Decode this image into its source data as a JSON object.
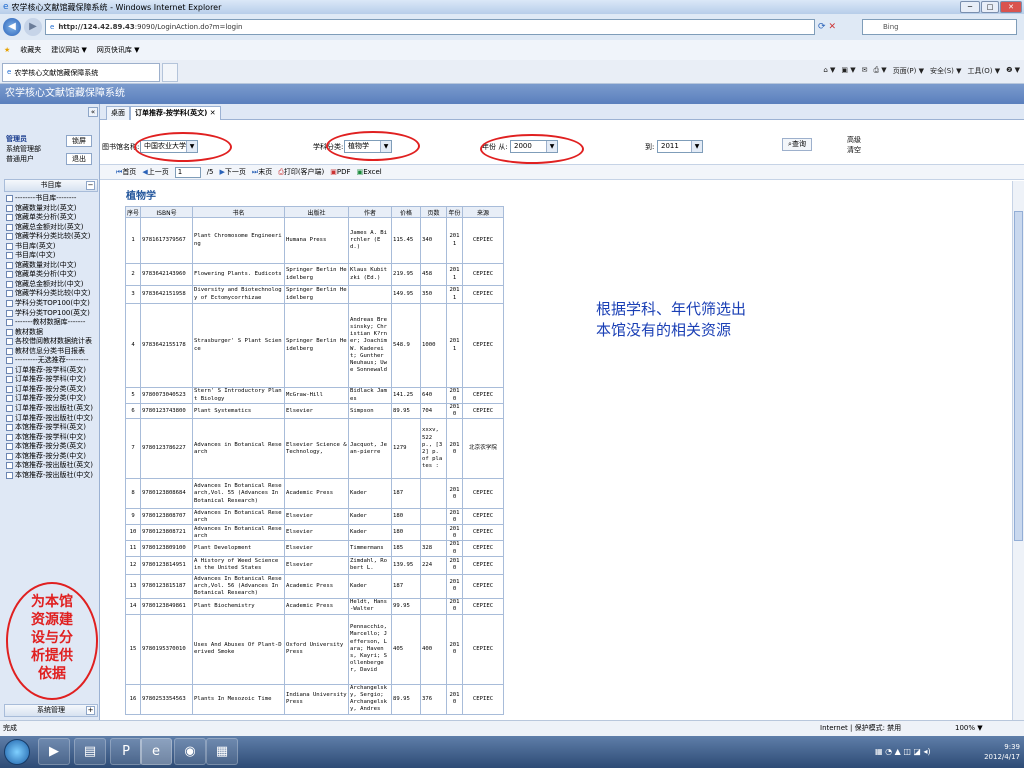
{
  "window": {
    "title": "农学核心文献馆藏保障系统 - Windows Internet Explorer",
    "min": "─",
    "max": "□",
    "close": "✕"
  },
  "address": {
    "url_prefix": "http://124.42.89.43",
    "url_suffix": ":9090/LoginAction.do?m=login",
    "search_placeholder": "Bing"
  },
  "favorites": {
    "fav": "收藏夹",
    "suggest": "建议网站 ▼",
    "gallery": "网页快讯库 ▼"
  },
  "browser_tab": {
    "label": "农学核心文献馆藏保障系统"
  },
  "ie_commands": [
    "页面(P) ▼",
    "安全(S) ▼",
    "工具(O) ▼",
    "❷ ▼"
  ],
  "app": {
    "header": "农学核心文献馆藏保障系统"
  },
  "user": {
    "title": "管理员",
    "lines": [
      "系统管理部",
      "普通用户"
    ],
    "lock_btn": "锁屏",
    "exit_btn": "退出"
  },
  "sidebar": {
    "section": "书目库",
    "items": [
      "--------书目库--------",
      "馆藏数量对比(英文)",
      "馆藏单类分析(英文)",
      "馆藏总金额对比(英文)",
      "馆藏学科分类比较(英文)",
      "书目库(英文)",
      "书目库(中文)",
      "馆藏数量对比(中文)",
      "馆藏单类分析(中文)",
      "馆藏总金额对比(中文)",
      "馆藏学科分类比较(中文)",
      "学科分类TOP100(中文)",
      "学科分类TOP100(英文)",
      "-------教材数据库-------",
      "教材数据",
      "各校借阅教材数据统计表",
      "教材信息分类书目报表",
      "---------无选推荐---------",
      "订单推荐-按学科(英文)",
      "订单推荐-按学科(中文)",
      "订单推荐-按分类(英文)",
      "订单推荐-按分类(中文)",
      "订单推荐-按出版社(英文)",
      "订单推荐-按出版社(中文)",
      "本馆推荐-按学科(英文)",
      "本馆推荐-按学科(中文)",
      "本馆推荐-按分类(英文)",
      "本馆推荐-按分类(中文)",
      "本馆推荐-按出版社(英文)",
      "本馆推荐-按出版社(中文)"
    ],
    "footer": "系统管理"
  },
  "callout_left": "为本馆资源建设与分析提供依据",
  "content_tabs": {
    "home": "桌面",
    "active": "订单推荐-按学科(英文) ✕"
  },
  "filters": {
    "library_label": "图书馆名称:",
    "library_value": "中国农业大学",
    "subject_label": "学科分类:",
    "subject_value": "植物学",
    "year_from_label": "年份 从:",
    "year_from_value": "2000",
    "year_to_label": "到:",
    "year_to_value": "2011",
    "query_btn": "查询",
    "advanced": "高级",
    "clear": "清空"
  },
  "pager": {
    "first": "首页",
    "prev": "上一页",
    "page": "1",
    "total": "/5",
    "next": "下一页",
    "last": "末页",
    "print": "打印(客户端)",
    "pdf": "PDF",
    "excel": "Excel"
  },
  "subject_title": "植物学",
  "table": {
    "headers": [
      "序号",
      "ISBN号",
      "书名",
      "出版社",
      "作者",
      "价格",
      "页数",
      "年份",
      "来源"
    ],
    "rows": [
      [
        "1",
        "9781617379567",
        "Plant Chromosome Engineering",
        "Humana Press",
        "James A. Birchler (Ed.)",
        "115.45",
        "340",
        "2011",
        "CEPIEC"
      ],
      [
        "2",
        "9783642143960",
        "Flowering Plants. Eudicots",
        "Springer Berlin Heidelberg",
        "Klaus Kubitzki (Ed.)",
        "219.95",
        "458",
        "2011",
        "CEPIEC"
      ],
      [
        "3",
        "9783642151958",
        "Diversity and Biotechnology of Ectomycorrhizae",
        "Springer Berlin Heidelberg",
        "",
        "149.95",
        "350",
        "2011",
        "CEPIEC"
      ],
      [
        "4",
        "9783642155178",
        "Strasburger' S Plant Science",
        "Springer Berlin Heidelberg",
        "Andreas Bresinsky; Christian K?rner; Joachim W. Kadereit; Gunther Neuhaus; Uwe Sonnewald",
        "548.9",
        "1000",
        "2011",
        "CEPIEC"
      ],
      [
        "5",
        "9780073040523",
        "Stern' S Introductory Plant Biology",
        "McGraw-Hill",
        "Bidlack James",
        "141.25",
        "640",
        "2010",
        "CEPIEC"
      ],
      [
        "6",
        "9780123743800",
        "Plant Systematics",
        "Elsevier",
        "Simpson",
        "89.95",
        "704",
        "2010",
        "CEPIEC"
      ],
      [
        "7",
        "9780123786227",
        "Advances in Botanical Research",
        "Elsevier Science & Technology,",
        "Jacquot, Jean-pierre",
        "1279",
        "",
        "2010",
        "北京农学院"
      ],
      [
        "8",
        "9780123808684",
        "Advances In Botanical Research,Vol. 55 (Advances In Botanical Research)",
        "Academic Press",
        "Kader",
        "187",
        "",
        "2010",
        "CEPIEC"
      ],
      [
        "9",
        "9780123808707",
        "Advances In Botanical Research",
        "Elsevier",
        "Kader",
        "180",
        "",
        "2010",
        "CEPIEC"
      ],
      [
        "10",
        "9780123808721",
        "Advances In Botanical Research",
        "Elsevier",
        "Kader",
        "180",
        "",
        "2010",
        "CEPIEC"
      ],
      [
        "11",
        "9780123809100",
        "Plant Development",
        "Elsevier",
        "Timmermans",
        "185",
        "328",
        "2010",
        "CEPIEC"
      ],
      [
        "12",
        "9780123814951",
        "A History of Weed Science in the United States",
        "Elsevier",
        "Zimdahl, Robert L.",
        "139.95",
        "224",
        "2010",
        "CEPIEC"
      ],
      [
        "13",
        "9780123815187",
        "Advances In Botanical Research,Vol. 56 (Advances In Botanical Research)",
        "Academic Press",
        "Kader",
        "187",
        "",
        "2010",
        "CEPIEC"
      ],
      [
        "14",
        "9780123849861",
        "Plant Biochemistry",
        "Academic Press",
        "Heldt, Hans-Walter",
        "99.95",
        "",
        "2010",
        "CEPIEC"
      ],
      [
        "15",
        "9780195370010",
        "Uses And Abuses Of Plant-Derived Smoke",
        "Oxford University Press",
        "Pennacchio, Marcello; Jefferson, Lara; Havens, Kayri; Sollenberger, David",
        "405",
        "400",
        "2010",
        "CEPIEC"
      ],
      [
        "16",
        "9780253354563",
        "Plants In Mesozoic Time",
        "Indiana University Press",
        "Archangelsky, Sergio; Archangelsky, Andres",
        "89.95",
        "376",
        "2010",
        "CEPIEC"
      ]
    ],
    "row7_pages": "xxxv, 522 p., [32] p. of plates :"
  },
  "note": [
    "根据学科、年代筛选出",
    "本馆没有的相关资源"
  ],
  "status": {
    "left": "完成",
    "zone": "Internet | 保护模式: 禁用",
    "zoom": "100% ▼"
  },
  "clock": {
    "time": "9:39",
    "date": "2012/4/17"
  }
}
